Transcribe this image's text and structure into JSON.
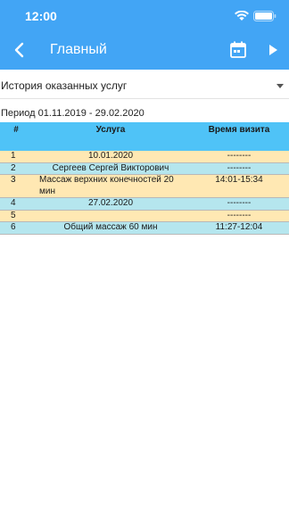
{
  "status": {
    "time": "12:00"
  },
  "appbar": {
    "title": "Главный"
  },
  "colors": {
    "accent": "#42a5f5",
    "header": "#4fc3f7",
    "row_odd": "#ffe8b3",
    "row_even": "#b5e6ee"
  },
  "filter": {
    "selected": "История оказанных услуг"
  },
  "period": "Период 01.11.2019 - 29.02.2020",
  "table": {
    "headers": {
      "num": "#",
      "service": "Услуга",
      "time": "Время визита"
    },
    "rows": [
      {
        "num": "1",
        "service": "10.01.2020",
        "time": "--------"
      },
      {
        "num": "2",
        "service": "Сергеев Сергей Викторович",
        "time": "--------"
      },
      {
        "num": "3",
        "service": "Массаж верхних конечностей 20 мин",
        "time": "14:01-15:34"
      },
      {
        "num": "4",
        "service": "27.02.2020",
        "time": "--------"
      },
      {
        "num": "5",
        "service": "",
        "time": "--------"
      },
      {
        "num": "6",
        "service": "Общий массаж 60 мин",
        "time": "11:27-12:04"
      }
    ]
  }
}
